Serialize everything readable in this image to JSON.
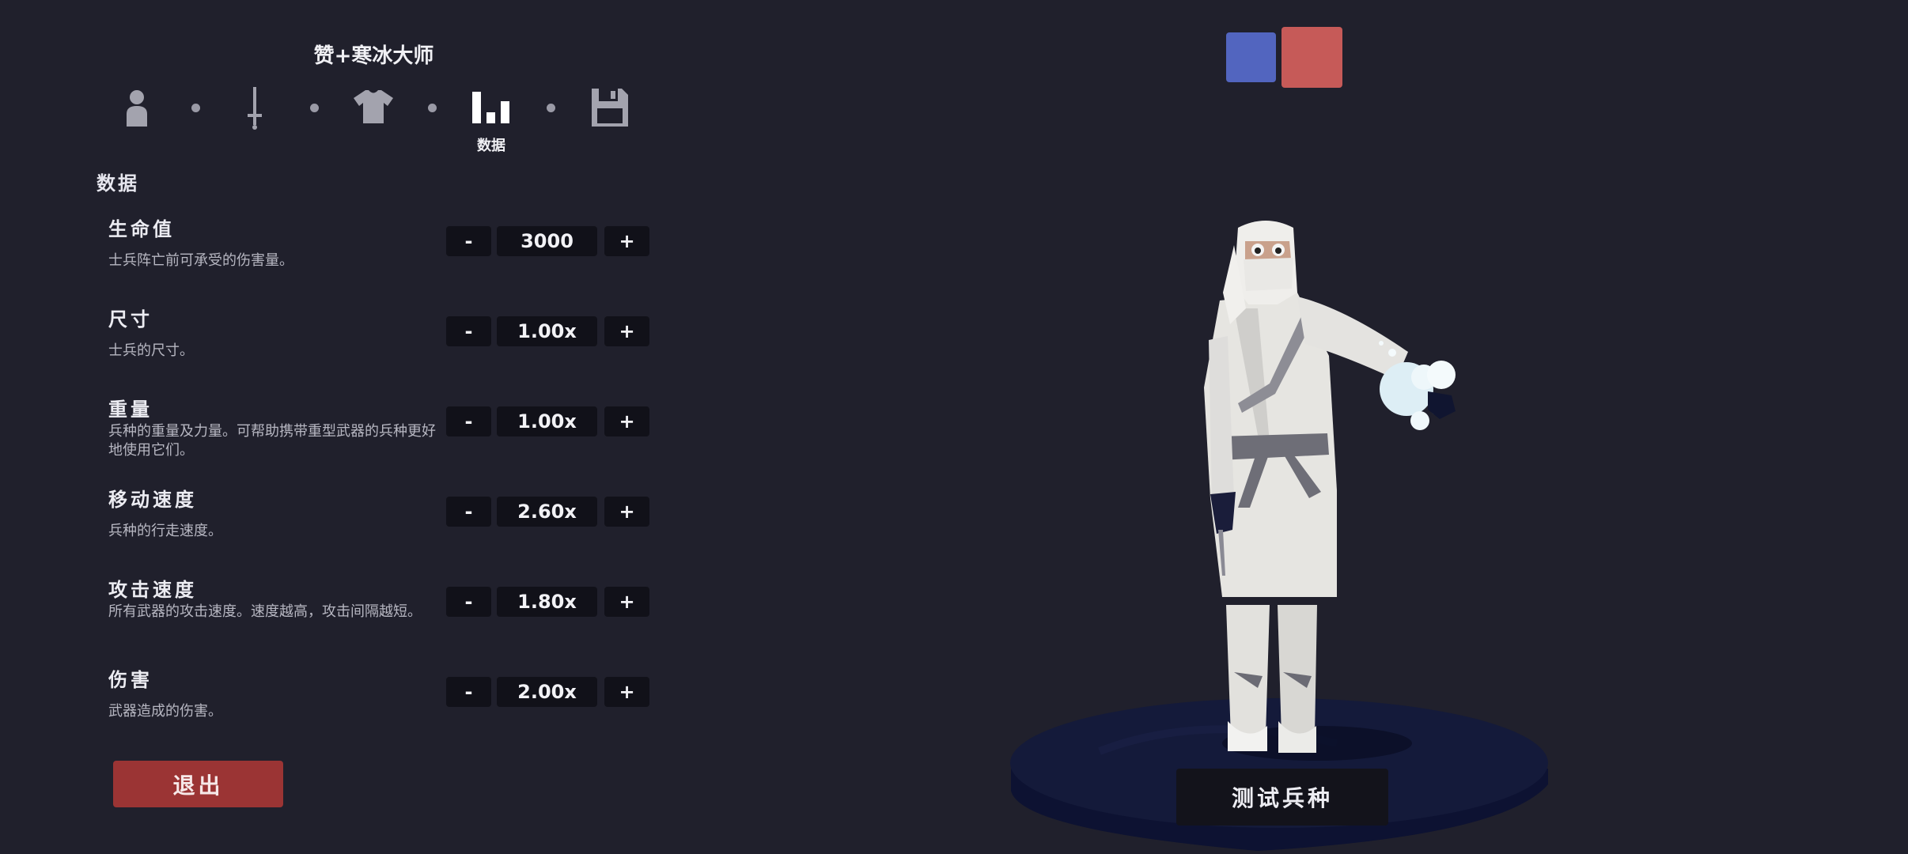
{
  "unit": {
    "title": "赞+寒冰大师"
  },
  "steps": [
    {
      "name": "unit-base",
      "icon": "person-icon",
      "label": ""
    },
    {
      "name": "weapon",
      "icon": "sword-icon",
      "label": ""
    },
    {
      "name": "clothing",
      "icon": "shirt-icon",
      "label": ""
    },
    {
      "name": "stats",
      "icon": "bar-chart-icon",
      "label": "数据"
    },
    {
      "name": "save",
      "icon": "floppy-disk-icon",
      "label": ""
    }
  ],
  "section": {
    "title": "数据"
  },
  "stats": [
    {
      "name": "生命值",
      "desc": "士兵阵亡前可承受的伤害量。",
      "value": "3000"
    },
    {
      "name": "尺寸",
      "desc": "士兵的尺寸。",
      "value": "1.00x"
    },
    {
      "name": "重量",
      "desc": "兵种的重量及力量。可帮助携带重型武器的兵种更好地使用它们。",
      "value": "1.00x"
    },
    {
      "name": "移动速度",
      "desc": "兵种的行走速度。",
      "value": "2.60x"
    },
    {
      "name": "攻击速度",
      "desc": "所有武器的攻击速度。速度越高，攻击间隔越短。",
      "value": "1.80x"
    },
    {
      "name": "伤害",
      "desc": "武器造成的伤害。",
      "value": "2.00x"
    }
  ],
  "controls": {
    "minus": "-",
    "plus": "+"
  },
  "buttons": {
    "exit": "退出",
    "test": "测试兵种"
  },
  "colors": {
    "background": "#20202c",
    "team_blue": "#5265bf",
    "team_red": "#c65a58",
    "exit_button": "#9b3434",
    "platform": "#141a3a"
  }
}
